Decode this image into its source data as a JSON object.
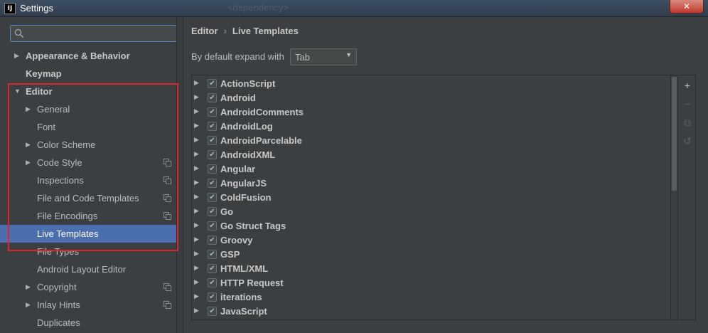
{
  "window": {
    "icon_text": "IJ",
    "title": "Settings",
    "background_text": "<dependency>",
    "close_label": "✕"
  },
  "sidebar": {
    "search": {
      "placeholder": "",
      "value": ""
    },
    "items": [
      {
        "label": "Appearance & Behavior",
        "bold": true,
        "arrow": "▶",
        "level": 0,
        "copy": false,
        "selected": false
      },
      {
        "label": "Keymap",
        "bold": true,
        "arrow": "",
        "level": 0,
        "copy": false,
        "selected": false
      },
      {
        "label": "Editor",
        "bold": true,
        "arrow": "▼",
        "level": 0,
        "copy": false,
        "selected": false
      },
      {
        "label": "General",
        "bold": false,
        "arrow": "▶",
        "level": 1,
        "copy": false,
        "selected": false
      },
      {
        "label": "Font",
        "bold": false,
        "arrow": "",
        "level": 1,
        "copy": false,
        "selected": false
      },
      {
        "label": "Color Scheme",
        "bold": false,
        "arrow": "▶",
        "level": 1,
        "copy": false,
        "selected": false
      },
      {
        "label": "Code Style",
        "bold": false,
        "arrow": "▶",
        "level": 1,
        "copy": true,
        "selected": false
      },
      {
        "label": "Inspections",
        "bold": false,
        "arrow": "",
        "level": 1,
        "copy": true,
        "selected": false
      },
      {
        "label": "File and Code Templates",
        "bold": false,
        "arrow": "",
        "level": 1,
        "copy": true,
        "selected": false
      },
      {
        "label": "File Encodings",
        "bold": false,
        "arrow": "",
        "level": 1,
        "copy": true,
        "selected": false
      },
      {
        "label": "Live Templates",
        "bold": false,
        "arrow": "",
        "level": 1,
        "copy": false,
        "selected": true
      },
      {
        "label": "File Types",
        "bold": false,
        "arrow": "",
        "level": 1,
        "copy": false,
        "selected": false
      },
      {
        "label": "Android Layout Editor",
        "bold": false,
        "arrow": "",
        "level": 1,
        "copy": false,
        "selected": false
      },
      {
        "label": "Copyright",
        "bold": false,
        "arrow": "▶",
        "level": 1,
        "copy": true,
        "selected": false
      },
      {
        "label": "Inlay Hints",
        "bold": false,
        "arrow": "▶",
        "level": 1,
        "copy": true,
        "selected": false
      },
      {
        "label": "Duplicates",
        "bold": false,
        "arrow": "",
        "level": 1,
        "copy": false,
        "selected": false
      }
    ]
  },
  "main": {
    "breadcrumb": {
      "parent": "Editor",
      "separator": "›",
      "current": "Live Templates"
    },
    "expand": {
      "label": "By default expand with",
      "value": "Tab"
    },
    "templates": [
      {
        "name": "ActionScript",
        "checked": true
      },
      {
        "name": "Android",
        "checked": true
      },
      {
        "name": "AndroidComments",
        "checked": true
      },
      {
        "name": "AndroidLog",
        "checked": true
      },
      {
        "name": "AndroidParcelable",
        "checked": true
      },
      {
        "name": "AndroidXML",
        "checked": true
      },
      {
        "name": "Angular",
        "checked": true
      },
      {
        "name": "AngularJS",
        "checked": true
      },
      {
        "name": "ColdFusion",
        "checked": true
      },
      {
        "name": "Go",
        "checked": true
      },
      {
        "name": "Go Struct Tags",
        "checked": true
      },
      {
        "name": "Groovy",
        "checked": true
      },
      {
        "name": "GSP",
        "checked": true
      },
      {
        "name": "HTML/XML",
        "checked": true
      },
      {
        "name": "HTTP Request",
        "checked": true
      },
      {
        "name": "iterations",
        "checked": true
      },
      {
        "name": "JavaScript",
        "checked": true
      }
    ],
    "tools": [
      {
        "icon": "add-icon",
        "glyph": "+",
        "enabled": true
      },
      {
        "icon": "remove-icon",
        "glyph": "−",
        "enabled": false
      },
      {
        "icon": "copy-icon",
        "glyph": "⧉",
        "enabled": false
      },
      {
        "icon": "restore-icon",
        "glyph": "↺",
        "enabled": false
      }
    ]
  },
  "colors": {
    "background": "#3c3f41",
    "selection": "#4b6eaf",
    "highlight_box": "#e0262d",
    "focus_border": "#5b8bc4"
  }
}
